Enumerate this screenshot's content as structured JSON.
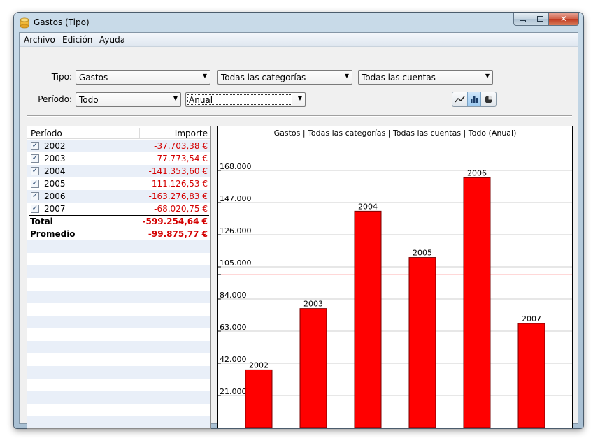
{
  "window": {
    "title": "Gastos (Tipo)"
  },
  "menu": [
    "Archivo",
    "Edición",
    "Ayuda"
  ],
  "filters": {
    "tipo_label": "Tipo:",
    "tipo_value": "Gastos",
    "categoria_value": "Todas las categorías",
    "cuenta_value": "Todas las cuentas",
    "periodo_label": "Período:",
    "periodo_value": "Todo",
    "agrupacion_value": "Anual"
  },
  "chart_switch": {
    "active": "bar-chart",
    "options": [
      "line-chart",
      "bar-chart",
      "pie-chart"
    ]
  },
  "table": {
    "headers": {
      "period": "Período",
      "amount": "Importe"
    },
    "rows": [
      {
        "year": "2002",
        "checked": true,
        "amount": "-37.703,38 €"
      },
      {
        "year": "2003",
        "checked": true,
        "amount": "-77.773,54 €"
      },
      {
        "year": "2004",
        "checked": true,
        "amount": "-141.353,60 €"
      },
      {
        "year": "2005",
        "checked": true,
        "amount": "-111.126,53 €"
      },
      {
        "year": "2006",
        "checked": true,
        "amount": "-163.276,83 €"
      },
      {
        "year": "2007",
        "checked": true,
        "amount": "-68.020,75 €"
      }
    ],
    "total": {
      "label": "Total",
      "amount": "-599.254,64 €"
    },
    "average": {
      "label": "Promedio",
      "amount": "-99.875,77 €"
    }
  },
  "colors": {
    "bar": "#ff0000",
    "negative_text": "#d40000",
    "average_line": "#ff6666"
  },
  "chart_data": {
    "type": "bar",
    "title": "Gastos | Todas las categorías | Todas las cuentas | Todo (Anual)",
    "categories": [
      "2002",
      "2003",
      "2004",
      "2005",
      "2006",
      "2007"
    ],
    "values": [
      37703.38,
      77773.54,
      141353.6,
      111126.53,
      163276.83,
      68020.75
    ],
    "average": 99875.77,
    "yticks": [
      "21.000",
      "42.000",
      "63.000",
      "84.000",
      "105.000",
      "126.000",
      "147.000",
      "168.000"
    ],
    "ylim": [
      0,
      189000
    ],
    "grid": true
  }
}
